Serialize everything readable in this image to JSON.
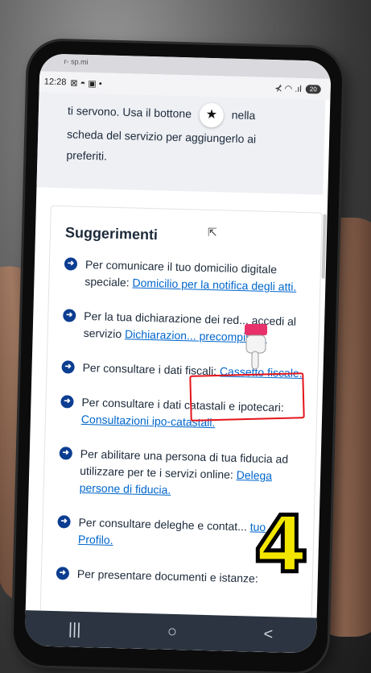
{
  "status": {
    "top_hint": "r- sp.mi",
    "time": "12:28",
    "left_icons": "⊠ ◓ ▣ •",
    "right_icons": "⊀ ◠ .ıl",
    "battery": "20"
  },
  "info": {
    "line1": "ti servono. Usa il bottone",
    "line1_after": "nella",
    "line2": "scheda del servizio per aggiungerlo ai",
    "line3": "preferiti."
  },
  "suggestions": {
    "title": "Suggerimenti",
    "items": [
      {
        "text": "Per comunicare il tuo domicilio digitale speciale: ",
        "link": "Domicilio per la notifica degli atti.",
        "suffix": ""
      },
      {
        "text": "Per la tua dichiarazione dei red... accedi al servizio ",
        "link": "Dichiarazion... precompilata.",
        "suffix": ""
      },
      {
        "text": "Per consultare i dati fiscali: ",
        "link": "Cassetto fiscale.",
        "suffix": ""
      },
      {
        "text": "Per consultare i dati catastali e ipotecari: ",
        "link": "Consultazioni ipo-catastali.",
        "suffix": ""
      },
      {
        "text": "Per abilitare una persona di tua fiducia ad utilizzare per te i servizi online: ",
        "link": "Delega persone di fiducia.",
        "suffix": ""
      },
      {
        "text": "Per consultare deleghe e contat... ",
        "link": "tuo Profilo.",
        "suffix": ""
      },
      {
        "text": "Per presentare documenti e istanze:",
        "link": "",
        "suffix": ""
      }
    ]
  },
  "overlay": {
    "step_number": "4"
  },
  "navbar": {
    "recent": "|||",
    "home": "○",
    "back": "<"
  },
  "colors": {
    "link": "#0066cc",
    "highlight": "#e4141b",
    "step_fill": "#f2e600",
    "arrow_bg": "#0b3d91"
  }
}
